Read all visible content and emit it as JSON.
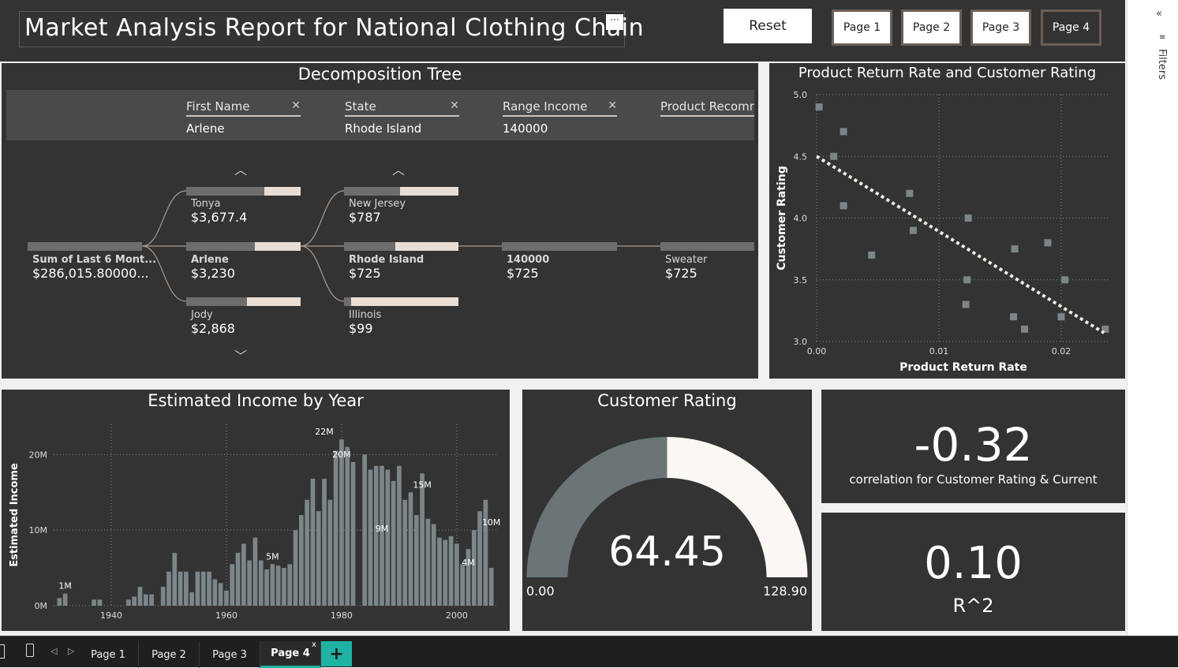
{
  "header": {
    "title": "Market Analysis Report for National Clothing Chain",
    "more_glyph": "···",
    "reset_label": "Reset",
    "page_buttons": [
      "Page 1",
      "Page 2",
      "Page 3",
      "Page 4"
    ]
  },
  "filters_pane": {
    "label": "Filters"
  },
  "tabs": {
    "items": [
      "Page 1",
      "Page 2",
      "Page 3",
      "Page 4"
    ],
    "active": "Page 4",
    "add_glyph": "+",
    "close_glyph": "x"
  },
  "decomposition": {
    "title": "Decomposition Tree",
    "levels": [
      {
        "header": "First Name",
        "value": "Arlene"
      },
      {
        "header": "State",
        "value": "Rhode Island"
      },
      {
        "header": "Range Income",
        "value": "140000"
      },
      {
        "header": "Product Recomm",
        "value": ""
      }
    ],
    "root": {
      "label": "Sum of Last 6 Mont...",
      "value": "$286,015.80000..."
    },
    "first_names": [
      {
        "label": "Tonya",
        "value": "$3,677.4",
        "fraction": 0.68
      },
      {
        "label": "Arlene",
        "value": "$3,230",
        "fraction": 0.6
      },
      {
        "label": "Jody",
        "value": "$2,868",
        "fraction": 0.53
      }
    ],
    "states": [
      {
        "label": "New Jersey",
        "value": "$787",
        "fraction": 0.49
      },
      {
        "label": "Rhode Island",
        "value": "$725",
        "fraction": 0.45
      },
      {
        "label": "Illinois",
        "value": "$99",
        "fraction": 0.06
      }
    ],
    "range_income": {
      "label": "140000",
      "value": "$725"
    },
    "product": {
      "label": "Sweater",
      "value": "$725"
    }
  },
  "scatter_chart": {
    "title": "Product Return Rate and Customer Rating"
  },
  "income_chart": {
    "title": "Estimated Income by Year"
  },
  "gauge": {
    "title": "Customer Rating",
    "value_label": "64.45",
    "min_label": "0.00",
    "max_label": "128.90",
    "value": 64.45,
    "min": 0,
    "max": 128.9,
    "colors": {
      "fill": "#6b7578",
      "track": "#fbf7f2"
    }
  },
  "cards": [
    {
      "value": "-0.32",
      "label": "correlation for Customer Rating & Current"
    },
    {
      "value": "0.10",
      "label": "R^2"
    }
  ],
  "chart_data": [
    {
      "type": "scatter",
      "title": "Product Return Rate and Customer Rating",
      "xlabel": "Product Return Rate",
      "ylabel": "Customer Rating",
      "xlim": [
        0.0,
        0.024
      ],
      "ylim": [
        3.0,
        5.0
      ],
      "xticks": [
        "0.00",
        "0.01",
        "0.02"
      ],
      "xtick_values": [
        0.0,
        0.01,
        0.02
      ],
      "yticks": [
        "3.0",
        "3.5",
        "4.0",
        "4.5",
        "5.0"
      ],
      "ytick_values": [
        3.0,
        3.5,
        4.0,
        4.5,
        5.0
      ],
      "grid": true,
      "points": [
        [
          0.0002,
          4.9
        ],
        [
          0.0022,
          4.7
        ],
        [
          0.0014,
          4.5
        ],
        [
          0.0022,
          4.1
        ],
        [
          0.0045,
          3.7
        ],
        [
          0.0076,
          4.2
        ],
        [
          0.0079,
          3.9
        ],
        [
          0.0124,
          4.0
        ],
        [
          0.0123,
          3.5
        ],
        [
          0.0122,
          3.3
        ],
        [
          0.0162,
          3.75
        ],
        [
          0.0161,
          3.2
        ],
        [
          0.017,
          3.1
        ],
        [
          0.0189,
          3.8
        ],
        [
          0.0203,
          3.5
        ],
        [
          0.02,
          3.2
        ],
        [
          0.0236,
          3.1
        ]
      ],
      "trendline": [
        [
          0.0,
          4.5
        ],
        [
          0.0235,
          3.07
        ]
      ],
      "colors": {
        "points": "#7c8689",
        "trend": "#f0ebe4"
      }
    },
    {
      "type": "bar",
      "title": "Estimated Income by Year",
      "xlabel": "",
      "ylabel": "Estimated Income",
      "xlim": [
        1930,
        2007
      ],
      "ylim": [
        0,
        24000000
      ],
      "xticks": [
        "1940",
        "1960",
        "1980",
        "2000"
      ],
      "xtick_values": [
        1940,
        1960,
        1980,
        2000
      ],
      "yticks": [
        "0M",
        "10M",
        "20M"
      ],
      "ytick_values": [
        0,
        10000000,
        20000000
      ],
      "grid": true,
      "x": [
        1931,
        1932,
        1934,
        1935,
        1937,
        1938,
        1939,
        1942,
        1943,
        1944,
        1945,
        1946,
        1947,
        1949,
        1950,
        1951,
        1952,
        1953,
        1954,
        1955,
        1956,
        1957,
        1958,
        1959,
        1960,
        1961,
        1962,
        1963,
        1964,
        1965,
        1966,
        1967,
        1968,
        1969,
        1970,
        1971,
        1972,
        1973,
        1974,
        1975,
        1976,
        1977,
        1978,
        1979,
        1980,
        1981,
        1982,
        1983,
        1984,
        1985,
        1986,
        1987,
        1988,
        1989,
        1990,
        1991,
        1992,
        1993,
        1994,
        1995,
        1996,
        1997,
        1998,
        1999,
        2000,
        2001,
        2002,
        2003,
        2004,
        2005,
        2006
      ],
      "values": [
        1000000,
        1600000,
        0,
        0,
        800000,
        800000,
        0,
        0,
        800000,
        1200000,
        2500000,
        1500000,
        1500000,
        2500000,
        4500000,
        7000000,
        4500000,
        4500000,
        1800000,
        4500000,
        4500000,
        4500000,
        3500000,
        3000000,
        2000000,
        5500000,
        7000000,
        8200000,
        6000000,
        9000000,
        6000000,
        4800000,
        5500000,
        5300000,
        5000000,
        5500000,
        10000000,
        12000000,
        14000000,
        16800000,
        12500000,
        16800000,
        14000000,
        20500000,
        22000000,
        21000000,
        19000000,
        0,
        20000000,
        18000000,
        18500000,
        18500000,
        18000000,
        16500000,
        18500000,
        14000000,
        15000000,
        12000000,
        17500000,
        11500000,
        10800000,
        9000000,
        8700000,
        9200000,
        8200000,
        5500000,
        7500000,
        10000000,
        12500000,
        14000000,
        5000000
      ],
      "data_labels": [
        {
          "x": 1932,
          "text": "1M",
          "value": 1600000
        },
        {
          "x": 1968,
          "text": "5M",
          "value": 5500000
        },
        {
          "x": 1977,
          "text": "22M",
          "value": 22000000
        },
        {
          "x": 1980,
          "text": "20M",
          "value": 19000000
        },
        {
          "x": 1987,
          "text": "9M",
          "value": 9200000
        },
        {
          "x": 1994,
          "text": "15M",
          "value": 15000000
        },
        {
          "x": 2002,
          "text": "4M",
          "value": 4700000
        },
        {
          "x": 2006,
          "text": "10M",
          "value": 10000000
        }
      ],
      "colors": {
        "bars": "#7c8689"
      }
    },
    {
      "type": "gauge",
      "title": "Customer Rating",
      "value": 64.45,
      "min": 0,
      "max": 128.9
    }
  ]
}
